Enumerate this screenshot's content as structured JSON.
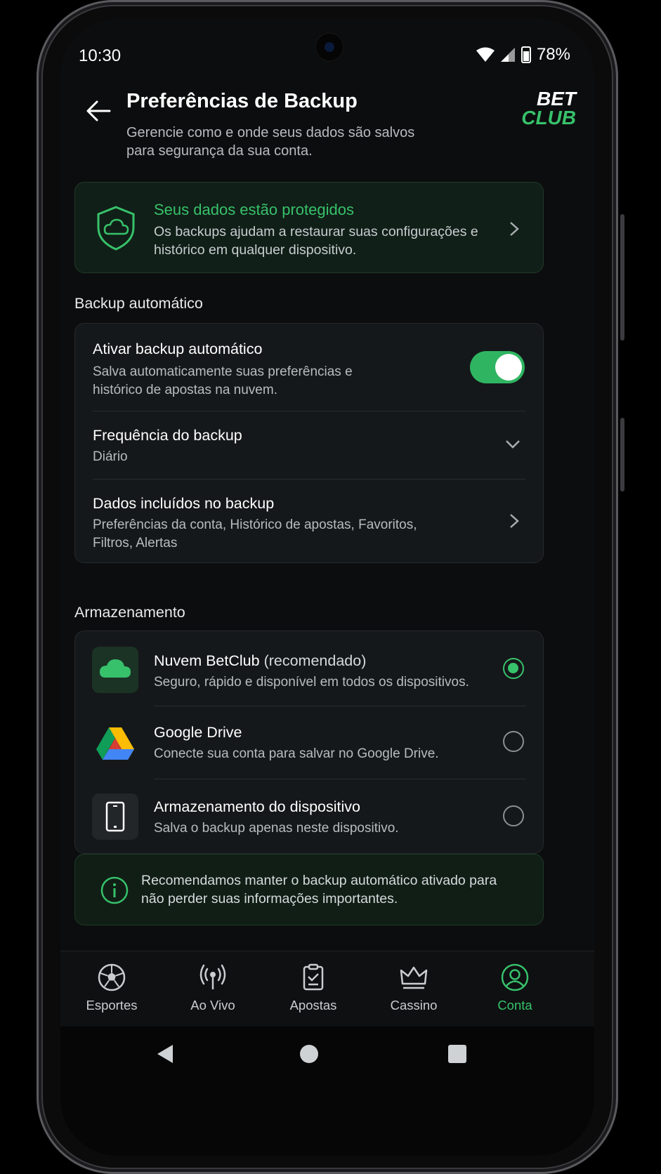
{
  "status_bar": {
    "time": "10:30",
    "battery": "78%"
  },
  "header": {
    "title": "Preferências de Backup",
    "subtitle": "Gerencie como e onde seus dados são salvos para segurança da sua conta.",
    "logo_line1": "BET",
    "logo_line2": "CLUB"
  },
  "protection_card": {
    "title": "Seus dados estão protegidos",
    "description": "Os backups ajudam a restaurar suas configurações e histórico em qualquer dispositivo."
  },
  "auto_backup": {
    "section_title": "Backup automático",
    "toggle_title": "Ativar backup automático",
    "toggle_description": "Salva automaticamente suas preferências e histórico de apostas na nuvem.",
    "toggle_on": true,
    "frequency_title": "Frequência do backup",
    "frequency_value": "Diário",
    "included_title": "Dados incluídos no backup",
    "included_value": "Preferências da conta, Histórico de apostas, Favoritos, Filtros, Alertas"
  },
  "storage": {
    "section_title": "Armazenamento",
    "options": [
      {
        "name": "Nuvem BetClub",
        "tag": "(recomendado)",
        "description": "Seguro, rápido e disponível em todos os dispositivos.",
        "selected": true,
        "icon": "cloud-icon"
      },
      {
        "name": "Google Drive",
        "tag": "",
        "description": "Conecte sua conta para salvar no Google Drive.",
        "selected": false,
        "icon": "google-drive-icon"
      },
      {
        "name": "Armazenamento do dispositivo",
        "tag": "",
        "description": "Salva o backup apenas neste dispositivo.",
        "selected": false,
        "icon": "phone-icon"
      }
    ]
  },
  "info_banner": {
    "text": "Recomendamos manter o backup automático ativado para não perder suas informações importantes."
  },
  "bottom_nav": [
    {
      "label": "Esportes",
      "icon": "soccer-ball-icon",
      "active": false
    },
    {
      "label": "Ao Vivo",
      "icon": "broadcast-icon",
      "active": false
    },
    {
      "label": "Apostas",
      "icon": "bet-slip-icon",
      "active": false
    },
    {
      "label": "Cassino",
      "icon": "crown-icon",
      "active": false
    },
    {
      "label": "Conta",
      "icon": "account-icon",
      "active": true
    }
  ],
  "colors": {
    "accent": "#37c16b",
    "background": "#0c0d0e",
    "card": "#15181a"
  }
}
